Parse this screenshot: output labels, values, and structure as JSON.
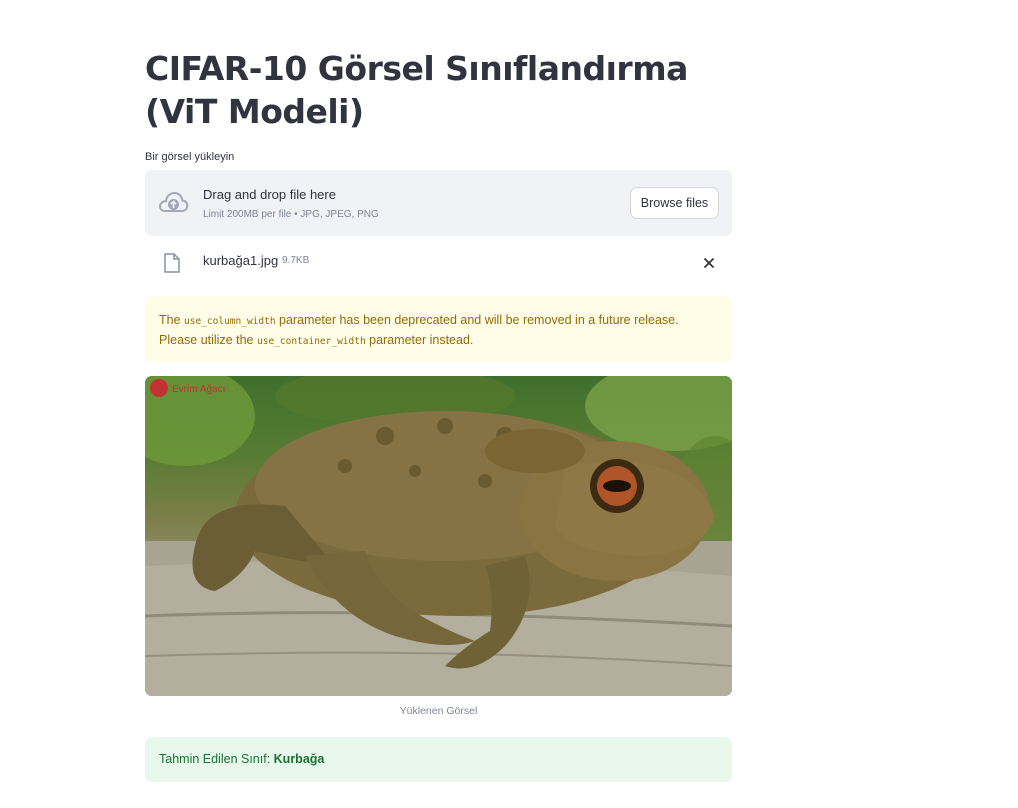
{
  "page": {
    "title": "CIFAR-10 Görsel Sınıflandırma (ViT Modeli)"
  },
  "uploader": {
    "label": "Bir görsel yükleyin",
    "drop_text": "Drag and drop file here",
    "limit_text": "Limit 200MB per file • JPG, JPEG, PNG",
    "browse_label": "Browse files",
    "upload_icon": "cloud-upload-icon"
  },
  "uploaded_file": {
    "name": "kurbağa1.jpg",
    "size": "9.7KB",
    "file_icon": "file-icon",
    "remove_icon": "close-icon"
  },
  "warning": {
    "prefix": "The",
    "code1": "use_column_width",
    "middle": "parameter has been deprecated and will be removed in a future release. Please utilize the",
    "code2": "use_container_width",
    "suffix": "parameter instead."
  },
  "image": {
    "watermark": "Evrim Ağacı",
    "caption": "Yüklenen Görsel"
  },
  "result": {
    "label": "Tahmin Edilen Sınıf:",
    "value": "Kurbağa"
  },
  "colors": {
    "warning_bg": "#fffce7",
    "warning_text": "#926c05",
    "success_bg": "#e8f8ec",
    "success_text": "#177233",
    "dropzone_bg": "#f0f2f6"
  }
}
